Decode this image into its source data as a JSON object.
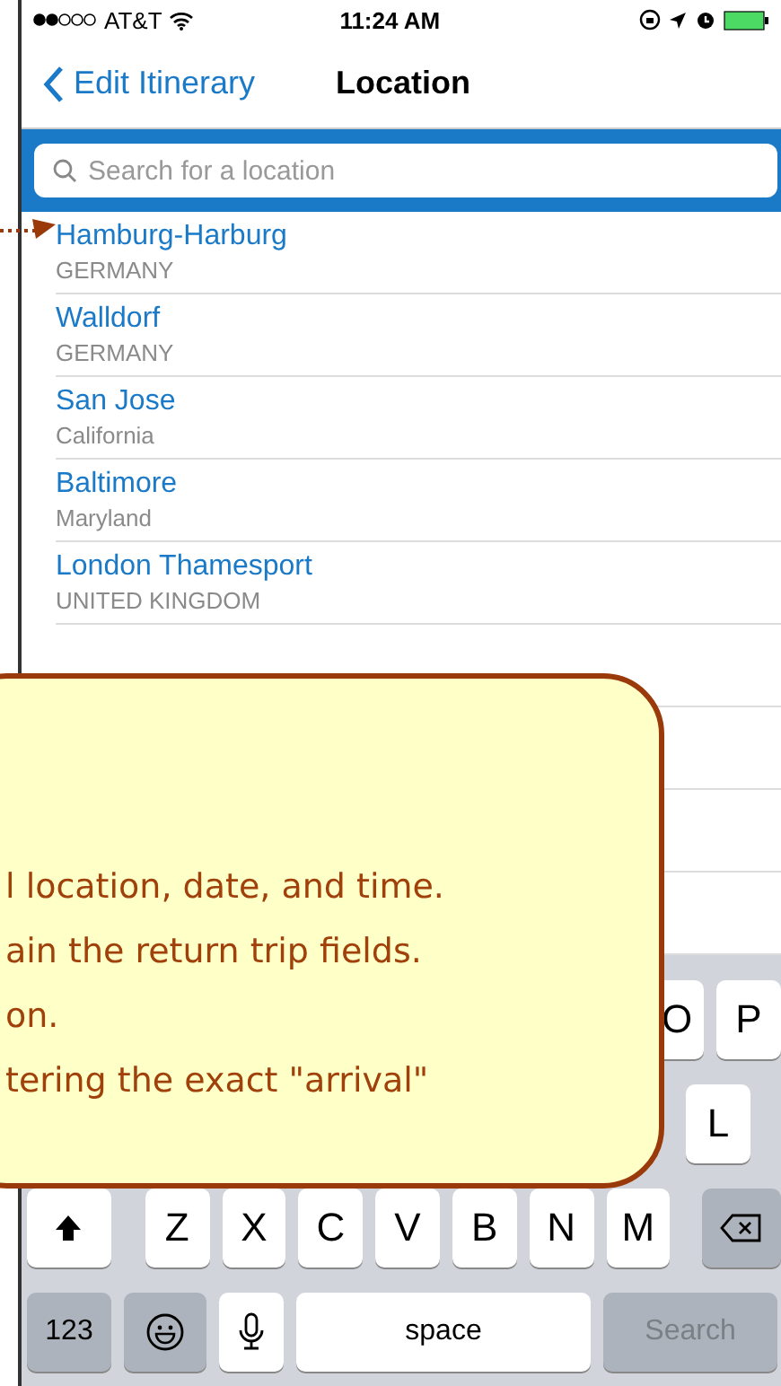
{
  "status_bar": {
    "carrier": "AT&T",
    "time": "11:24 AM"
  },
  "nav": {
    "back": "Edit Itinerary",
    "title": "Location"
  },
  "search": {
    "placeholder": "Search for a location"
  },
  "locations": [
    {
      "name": "Hamburg-Harburg",
      "region": "GERMANY"
    },
    {
      "name": "Walldorf",
      "region": "GERMANY"
    },
    {
      "name": "San Jose",
      "region": "California"
    },
    {
      "name": "Baltimore",
      "region": "Maryland"
    },
    {
      "name": "London Thamesport",
      "region": "UNITED KINGDOM"
    }
  ],
  "callout": {
    "lines": [
      "l location, date, and time.",
      "ain the return trip fields.",
      "on.",
      "tering the exact \"arrival\""
    ]
  },
  "keyboard": {
    "rows": [
      {
        "keys": [
          {
            "kind": "letter",
            "label": "O"
          },
          {
            "kind": "letter",
            "label": "P"
          }
        ]
      },
      {
        "keys": [
          {
            "kind": "letter",
            "label": "L"
          }
        ]
      },
      {
        "keys": [
          {
            "kind": "shift"
          },
          {
            "kind": "letter",
            "label": "Z"
          },
          {
            "kind": "letter",
            "label": "X"
          },
          {
            "kind": "letter",
            "label": "C"
          },
          {
            "kind": "letter",
            "label": "V"
          },
          {
            "kind": "letter",
            "label": "B"
          },
          {
            "kind": "letter",
            "label": "N"
          },
          {
            "kind": "letter",
            "label": "M"
          },
          {
            "kind": "delete"
          }
        ]
      },
      {
        "keys": [
          {
            "kind": "mode",
            "label": "123"
          },
          {
            "kind": "emoji"
          },
          {
            "kind": "mic"
          },
          {
            "kind": "space",
            "label": "space"
          },
          {
            "kind": "return",
            "label": "Search",
            "disabled": true
          }
        ]
      }
    ]
  }
}
